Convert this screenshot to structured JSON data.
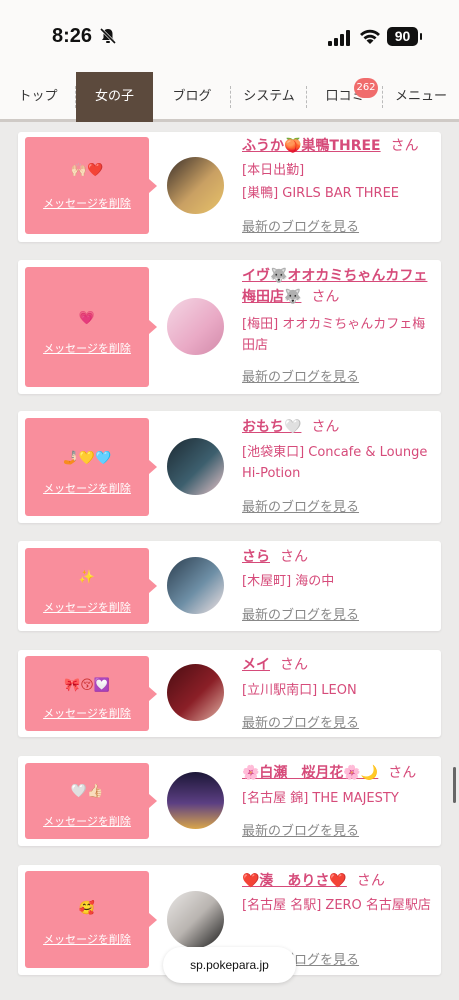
{
  "status_bar": {
    "time": "8:26",
    "battery": "90"
  },
  "nav": {
    "tabs": [
      {
        "label": "トップ"
      },
      {
        "label": "女の子"
      },
      {
        "label": "ブログ"
      },
      {
        "label": "システム"
      },
      {
        "label": "口コミ"
      },
      {
        "label": "メニュー"
      }
    ],
    "review_badge": "262"
  },
  "cards": [
    {
      "emoji": "🙌🏻❤️",
      "delete_label": "メッセージを削除",
      "name": "ふうか🍑巣鴨THREE",
      "honorific": "さん",
      "lines": [
        "[本日出勤]",
        "[巣鴨] GIRLS BAR THREE"
      ],
      "blog_link": "最新のブログを見る"
    },
    {
      "emoji": "💗",
      "delete_label": "メッセージを削除",
      "name": "イヴ🐺オオカミちゃんカフェ梅田店🐺",
      "honorific": "さん",
      "lines": [
        "[梅田] オオカミちゃんカフェ梅田店"
      ],
      "blog_link": "最新のブログを見る"
    },
    {
      "emoji": "🤳🏻💛🩵",
      "delete_label": "メッセージを削除",
      "name": "おもち🤍",
      "honorific": "さん",
      "lines": [
        "[池袋東口] Concafe & Lounge Hi-Potion"
      ],
      "blog_link": "最新のブログを見る"
    },
    {
      "emoji": "✨",
      "delete_label": "メッセージを削除",
      "name": "さら",
      "honorific": "さん",
      "lines": [
        "[木屋町] 海の中"
      ],
      "blog_link": "最新のブログを見る"
    },
    {
      "emoji": "🎀😚💟",
      "delete_label": "メッセージを削除",
      "name": "メイ",
      "honorific": "さん",
      "lines": [
        "[立川駅南口] LEON"
      ],
      "blog_link": "最新のブログを見る"
    },
    {
      "emoji": "🤍👍🏻",
      "delete_label": "メッセージを削除",
      "name": "🌸白瀬　桜月花🌸🌙",
      "honorific": "さん",
      "lines": [
        "[名古屋 錦] THE MAJESTY"
      ],
      "blog_link": "最新のブログを見る"
    },
    {
      "emoji": "🥰",
      "delete_label": "メッセージを削除",
      "name": "❤️湊　ありさ❤️",
      "honorific": "さん",
      "lines": [
        "[名古屋 名駅] ZERO 名古屋駅店"
      ],
      "blog_link": "最新のブログを見る"
    }
  ],
  "url_bar": {
    "domain": "sp.pokepara.jp"
  }
}
